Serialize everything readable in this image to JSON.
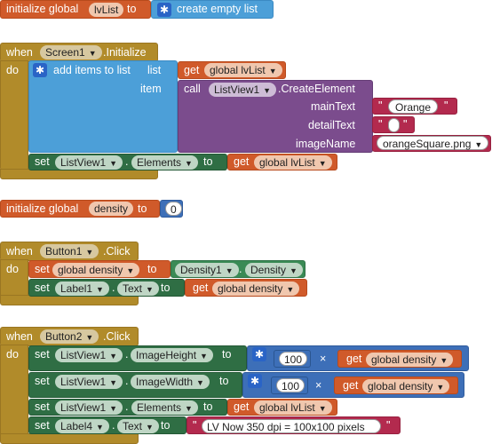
{
  "block1": {
    "init": "initialize global",
    "var": "lvList",
    "to": "to",
    "create": "create empty list"
  },
  "block2": {
    "when": "when",
    "component": "Screen1",
    "event": ".Initialize",
    "do": "do",
    "add_items": "add items to list",
    "list": "list",
    "item": "item",
    "get": "get",
    "global_lvlist": "global lvList",
    "call": "call",
    "listview": "ListView1",
    "create_element": ".CreateElement",
    "main_text": "mainText",
    "detail_text": "detailText",
    "image_name": "imageName",
    "orange": "Orange",
    "empty": "",
    "image_file": "orangeSquare.png",
    "set": "set",
    "dot": ".",
    "elements": "Elements",
    "to": "to",
    "get2": "get",
    "global_lvlist2": "global lvList"
  },
  "block3": {
    "init": "initialize global",
    "var": "density",
    "to": "to",
    "value": "0"
  },
  "block4": {
    "when": "when",
    "component": "Button1",
    "event": ".Click",
    "do": "do",
    "set": "set",
    "global_density": "global density",
    "to": "to",
    "density_comp": "Density1",
    "dot": ".",
    "density_prop": "Density",
    "set2": "set",
    "label": "Label1",
    "text": "Text",
    "to2": "to",
    "get": "get",
    "global_density2": "global density"
  },
  "block5": {
    "when": "when",
    "component": "Button2",
    "event": ".Click",
    "do": "do",
    "set": "set",
    "listview": "ListView1",
    "dot": ".",
    "image_height": "ImageHeight",
    "to": "to",
    "n100": "100",
    "times": "×",
    "get": "get",
    "global_density": "global density",
    "image_width": "ImageWidth",
    "elements": "Elements",
    "global_lvlist": "global lvList",
    "label4": "Label4",
    "text": "Text",
    "string": "LV Now 350 dpi = 100x100 pixels",
    "quote": "\""
  },
  "colors": {
    "variable": "#d05a2a",
    "event": "#b18b2a",
    "list": "#4c9fd8",
    "component_method": "#7b4c8d",
    "component_setter": "#2f6e44",
    "text": "#b32a4e",
    "math": "#3d6fb8"
  }
}
